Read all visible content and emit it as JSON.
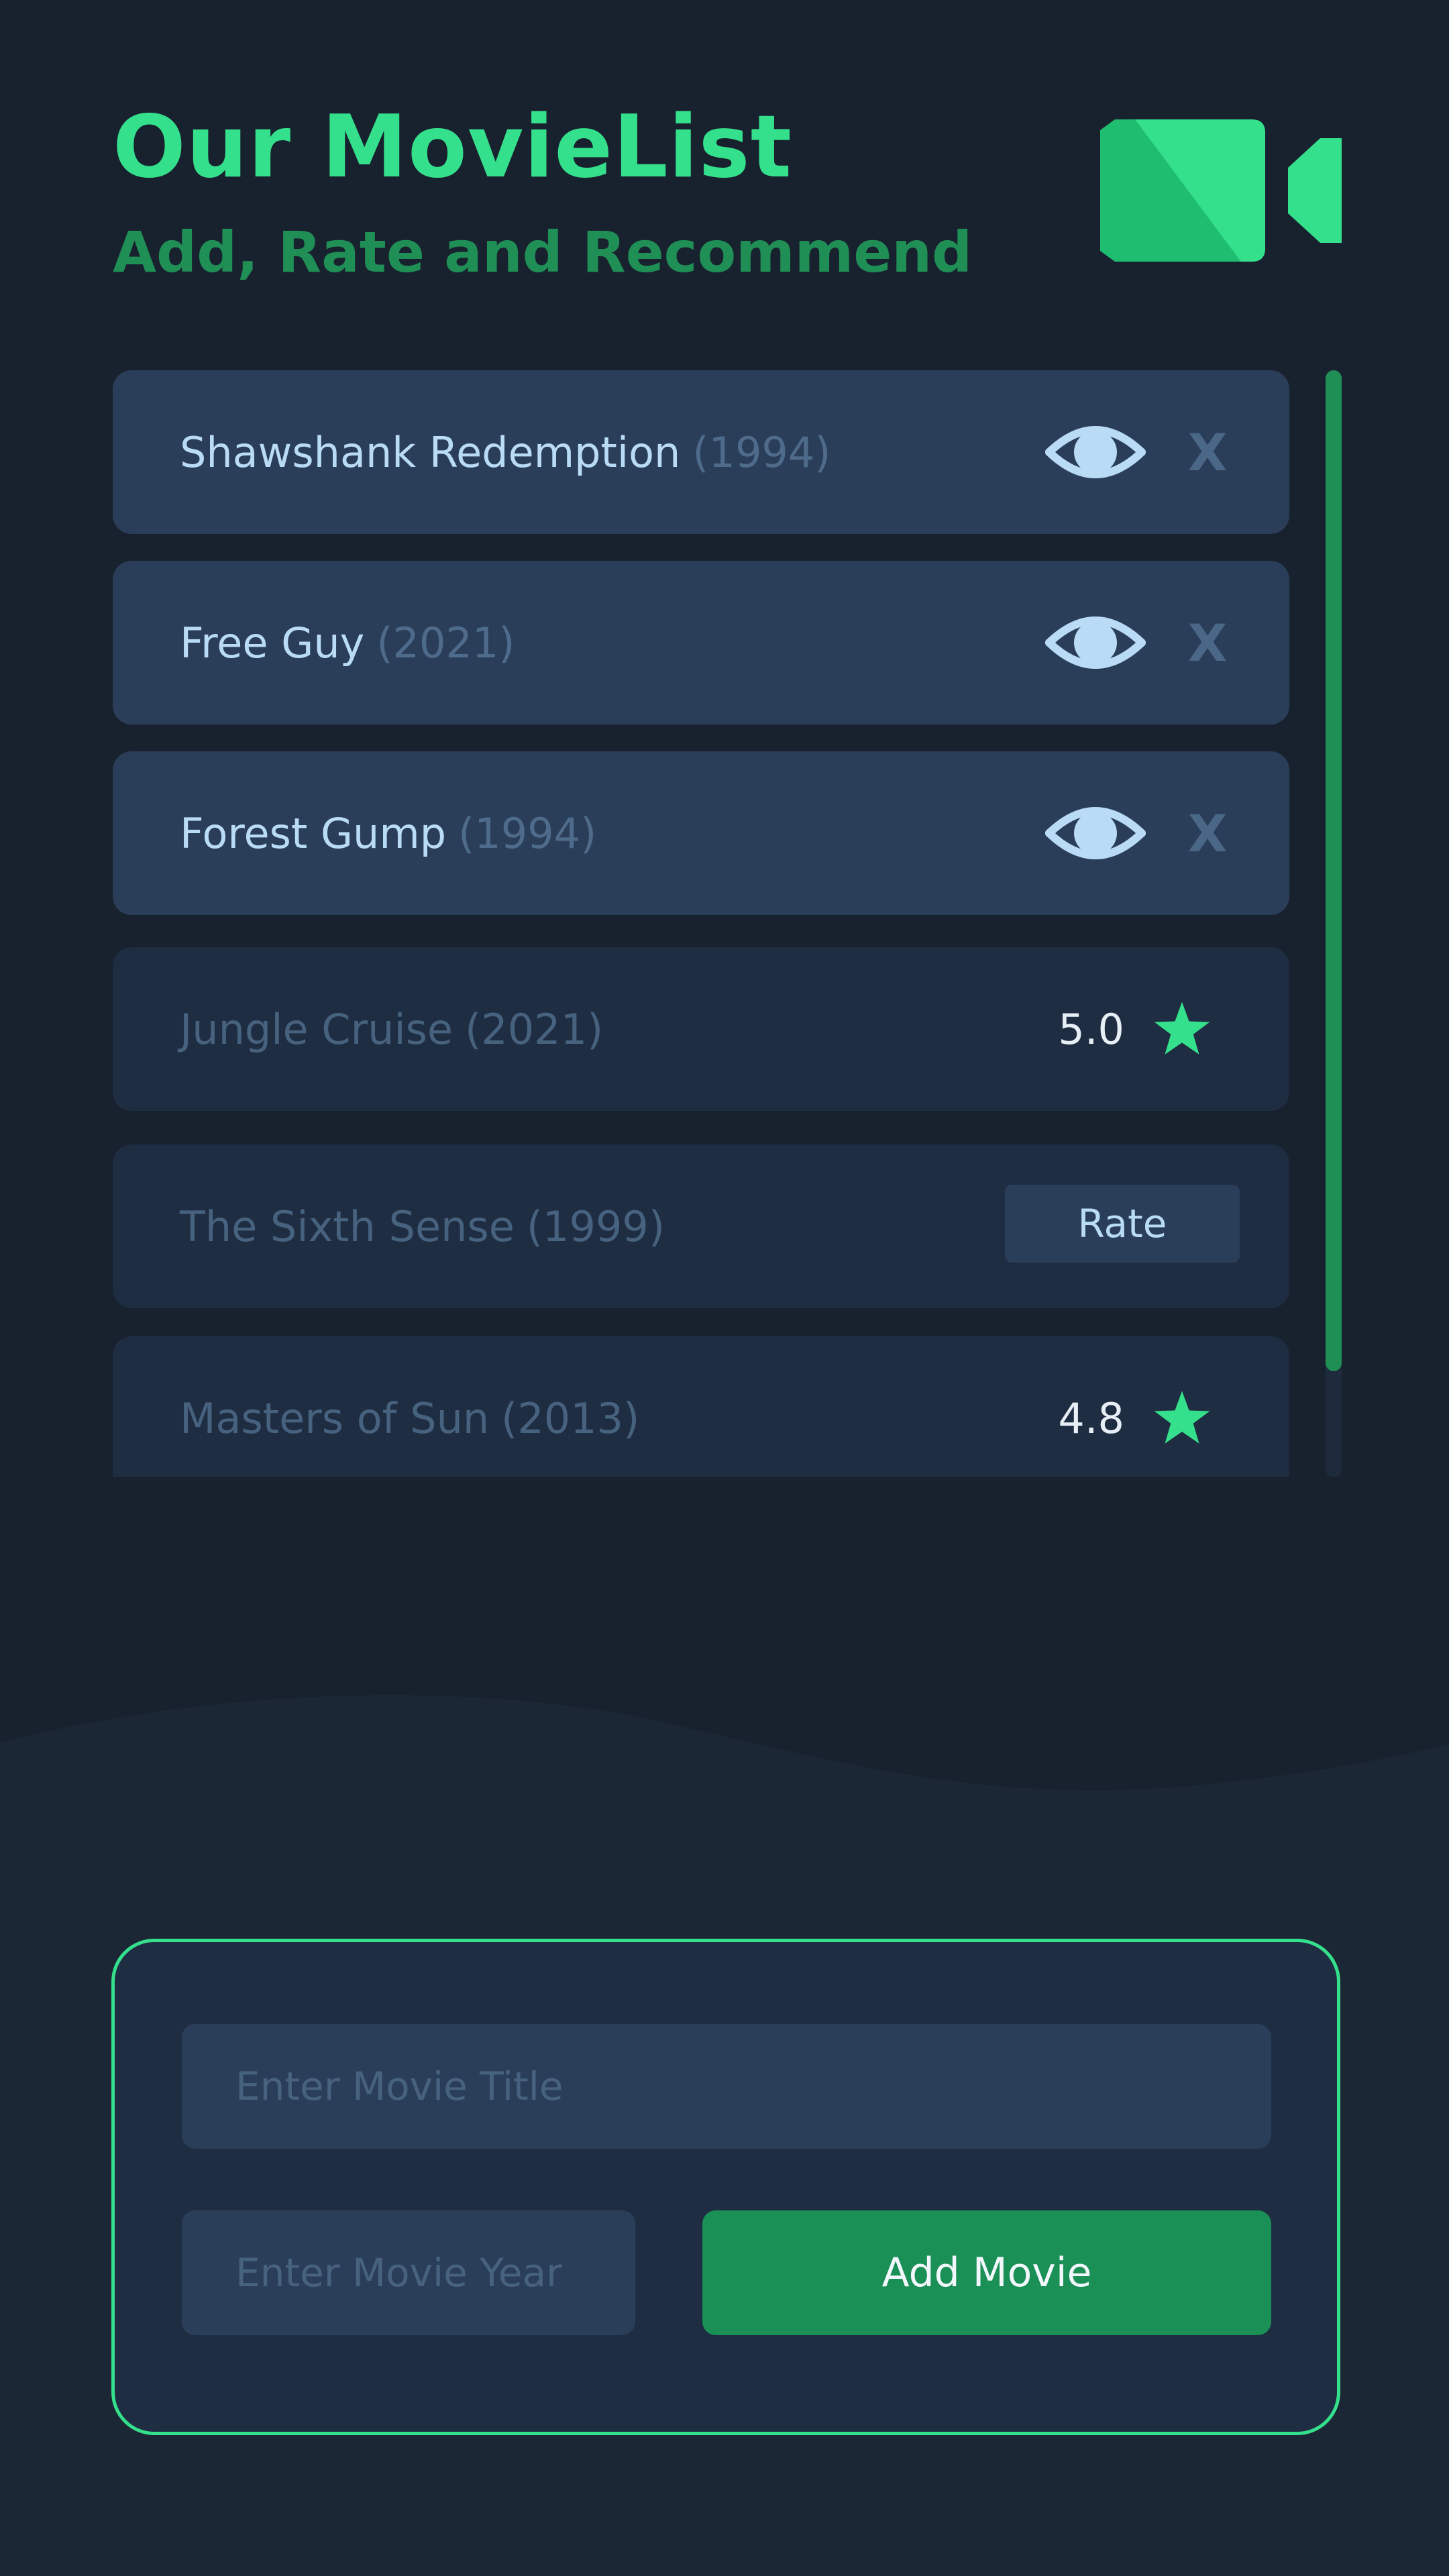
{
  "header": {
    "title": "Our MovieList",
    "subtitle": "Add, Rate and Recommend",
    "logo_icon": "video-camera-icon"
  },
  "movies": [
    {
      "title": "Shawshank Redemption",
      "year": "(1994)",
      "watched": false
    },
    {
      "title": "Free Guy",
      "year": "(2021)",
      "watched": false
    },
    {
      "title": "Forest Gump",
      "year": "(1994)",
      "watched": false
    },
    {
      "title": "Jungle Cruise",
      "year": "(2021)",
      "watched": true,
      "rating": "5.0"
    },
    {
      "title": "The Sixth Sense",
      "year": "(1999)",
      "watched": true,
      "rate_label": "Rate"
    },
    {
      "title": "Masters of Sun",
      "year": "(2013)",
      "watched": true,
      "rating": "4.8"
    }
  ],
  "actions": {
    "remove_label": "X",
    "mark_watched_icon": "eye-icon",
    "rating_icon": "star-icon"
  },
  "form": {
    "title_placeholder": "Enter Movie Title",
    "year_placeholder": "Enter Movie Year",
    "add_button_label": "Add Movie"
  },
  "colors": {
    "background": "#18222f",
    "accent": "#35e08c",
    "accent_dark": "#1f8f55",
    "card_unwatched": "#2b3e59",
    "card_watched": "#1f2d42"
  }
}
